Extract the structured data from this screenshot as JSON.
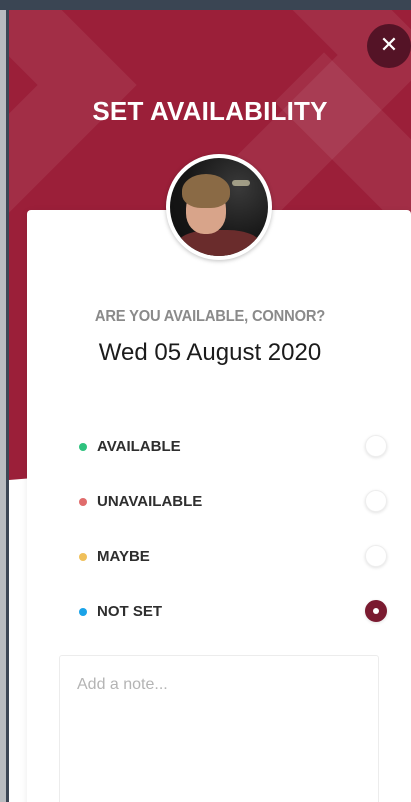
{
  "dialog": {
    "title": "SET AVAILABILITY",
    "close_label": "✕",
    "question": "ARE YOU AVAILABLE, CONNOR?",
    "date": "Wed 05 August 2020"
  },
  "options": [
    {
      "label": "AVAILABLE",
      "color": "#2ec27e",
      "selected": false
    },
    {
      "label": "UNAVAILABLE",
      "color": "#e06c6c",
      "selected": false
    },
    {
      "label": "MAYBE",
      "color": "#f0c05a",
      "selected": false
    },
    {
      "label": "NOT SET",
      "color": "#1aa3e8",
      "selected": true
    }
  ],
  "note": {
    "placeholder": "Add a note...",
    "value": ""
  },
  "colors": {
    "brand": "#9b1f39",
    "selected_radio": "#7a1a30"
  }
}
